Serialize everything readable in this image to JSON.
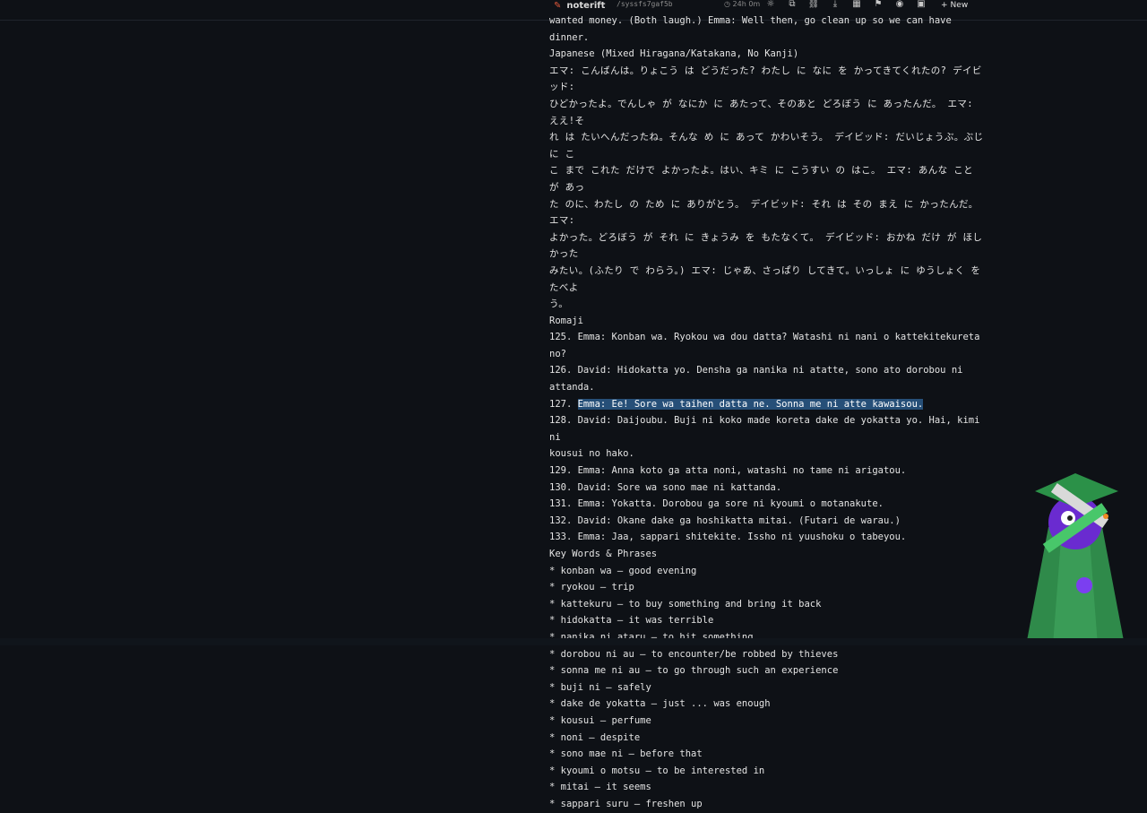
{
  "app": {
    "name": "noterift",
    "doc_id": "/syssfs7gaf5b",
    "timer": "24h 0m",
    "new_label": "New"
  },
  "toolbar_icons": [
    "sun-icon",
    "copy-icon",
    "link-icon",
    "pencil-icon",
    "download-icon",
    "grid-icon",
    "flag-icon",
    "eye-icon",
    "lock-icon"
  ],
  "content": {
    "lines": [
      "wanted money. (Both laugh.) Emma: Well then, go clean up so we can have dinner.",
      "Japanese (Mixed Hiragana/Katakana, No Kanji)",
      "エマ: こんばんは。りょこう は どうだった? わたし に なに を かってきてくれたの? デイビッド:",
      "ひどかったよ。でんしゃ が なにか に あたって、そのあと どろぼう に あったんだ。 エマ: ええ!そ",
      "れ は たいへんだったね。そんな め に あって かわいそう。 デイビッド: だいじょうぶ。ぶじ に こ",
      "こ まで これた だけで よかったよ。はい、キミ に こうすい の はこ。 エマ: あんな こと が あっ",
      "た のに、わたし の ため に ありがとう。 デイビッド: それ は その まえ に かったんだ。 エマ:",
      "よかった。どろぼう が それ に きょうみ を もたなくて。 デイビッド: おかね だけ が ほしかった",
      "みたい。(ふたり で わらう。) エマ: じゃあ、さっぱり してきて。いっしょ に ゆうしょく を たべよ",
      "う。",
      "Romaji",
      "125. Emma: Konban wa. Ryokou wa dou datta? Watashi ni nani o kattekitekureta no?",
      "126. David: Hidokatta yo. Densha ga nanika ni atatte, sono ato dorobou ni",
      "attanda.",
      "__SEL__",
      "128. David: Daijoubu. Buji ni koko made koreta dake de yokatta yo. Hai, kimi ni",
      "kousui no hako.",
      "129. Emma: Anna koto ga atta noni, watashi no tame ni arigatou.",
      "130. David: Sore wa sono mae ni kattanda.",
      "131. Emma: Yokatta. Dorobou ga sore ni kyoumi o motanakute.",
      "132. David: Okane dake ga hoshikatta mitai. (Futari de warau.)",
      "133. Emma: Jaa, sappari shitekite. Issho ni yuushoku o tabeyou.",
      "Key Words & Phrases",
      "* konban wa — good evening",
      "* ryokou — trip",
      "* kattekuru — to buy something and bring it back",
      "* hidokatta — it was terrible",
      "* nanika ni ataru — to hit something",
      "* dorobou ni au — to encounter/be robbed by thieves",
      "* sonna me ni au — to go through such an experience",
      "* buji ni — safely",
      "* dake de yokatta — just ... was enough",
      "* kousui — perfume",
      "* noni — despite",
      "* sono mae ni — before that",
      "* kyoumi o motsu — to be interested in",
      "* mitai — it seems",
      "* sappari suru — freshen up"
    ],
    "selected_prefix": "127. ",
    "selected_text": "Emma: Ee! Sore wa taihen datta ne. Sonna me ni atte kawaisou."
  },
  "colors": {
    "background": "#0e1116",
    "selection": "#264f78",
    "brand": "#e45a3c"
  }
}
